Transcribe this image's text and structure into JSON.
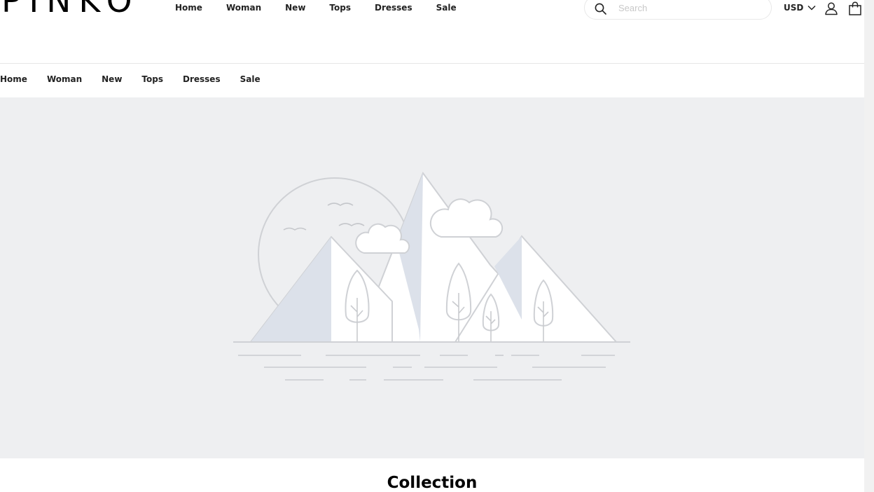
{
  "brand": {
    "logo_text": "PINKO"
  },
  "nav_primary": [
    "Home",
    "Woman",
    "New",
    "Tops",
    "Dresses",
    "Sale"
  ],
  "nav_secondary": [
    "Home",
    "Woman",
    "New",
    "Tops",
    "Dresses",
    "Sale"
  ],
  "search": {
    "placeholder": "Search",
    "value": ""
  },
  "currency": {
    "selected": "USD"
  },
  "icons": {
    "search": "search-icon",
    "currency_dropdown": "chevron-down-icon",
    "account": "user-icon",
    "cart": "bag-icon",
    "hero": "image-placeholder-icon"
  },
  "hero": {
    "background": "#eeeff1"
  },
  "section": {
    "title": "Collection"
  }
}
